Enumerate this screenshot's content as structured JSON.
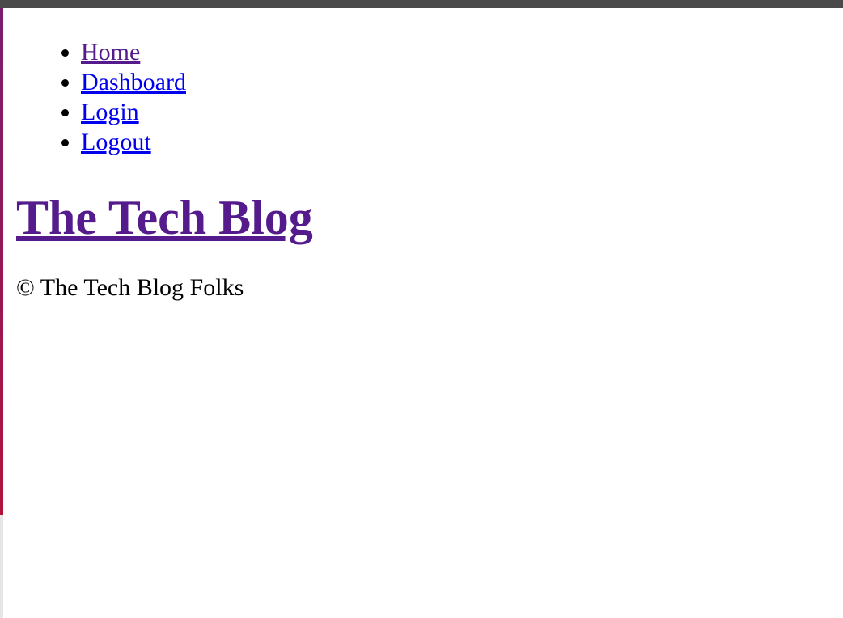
{
  "nav": {
    "items": [
      {
        "label": "Home"
      },
      {
        "label": "Dashboard"
      },
      {
        "label": "Login"
      },
      {
        "label": "Logout"
      }
    ]
  },
  "header": {
    "title": "The Tech Blog"
  },
  "footer": {
    "text": "© The Tech Blog Folks"
  },
  "colors": {
    "link": "#0000ee",
    "link_visited": "#551a8b",
    "top_bar": "#4a4a4a"
  }
}
